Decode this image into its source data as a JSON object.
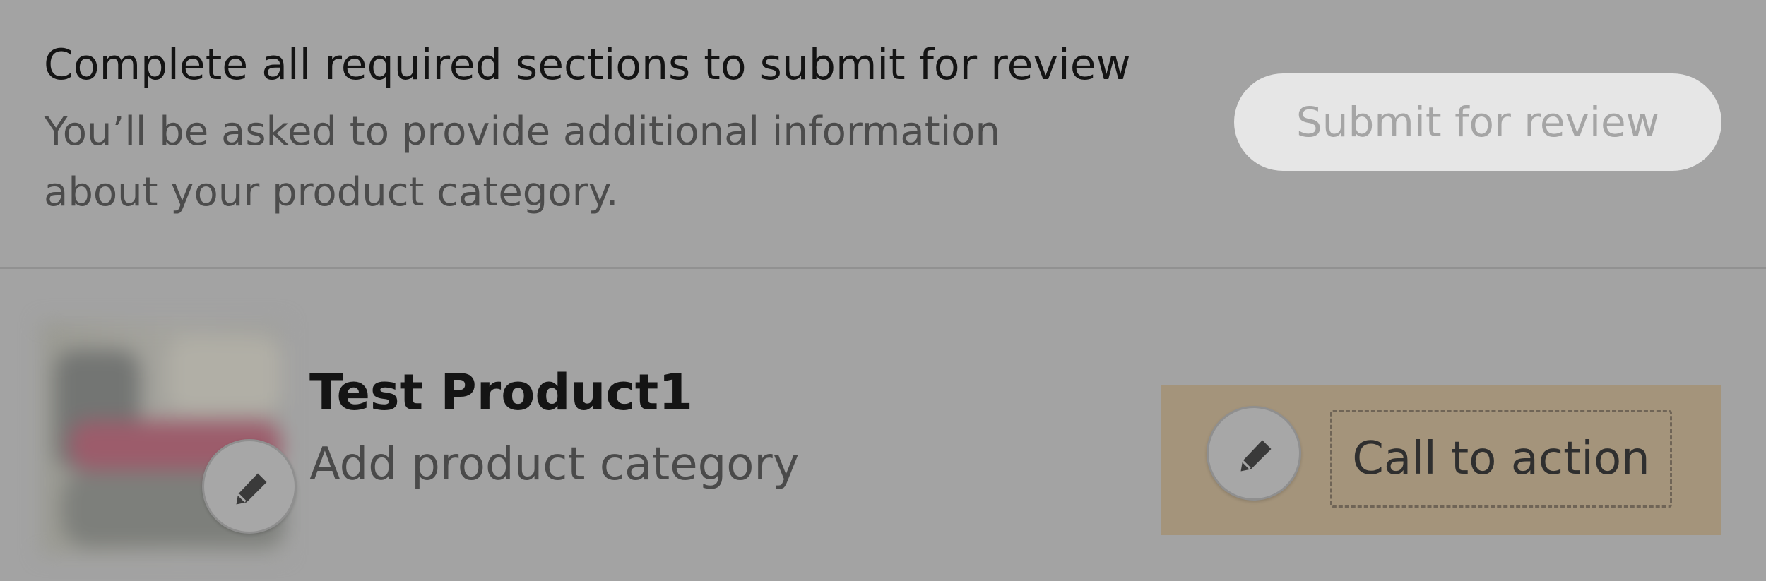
{
  "review": {
    "title": "Complete all required sections to submit for review",
    "description": "You’ll be asked to provide additional information about your product category.",
    "submit_label": "Submit for review"
  },
  "product": {
    "name": "Test Product1",
    "category_prompt": "Add product category",
    "cta_label": "Call to action"
  },
  "icons": {
    "thumbnail_edit": "pencil-icon",
    "cta_edit": "pencil-icon"
  },
  "colors": {
    "background": "#a3a3a3",
    "cta_highlight": "#a4947b",
    "submit_button": "#e6e6e6"
  }
}
